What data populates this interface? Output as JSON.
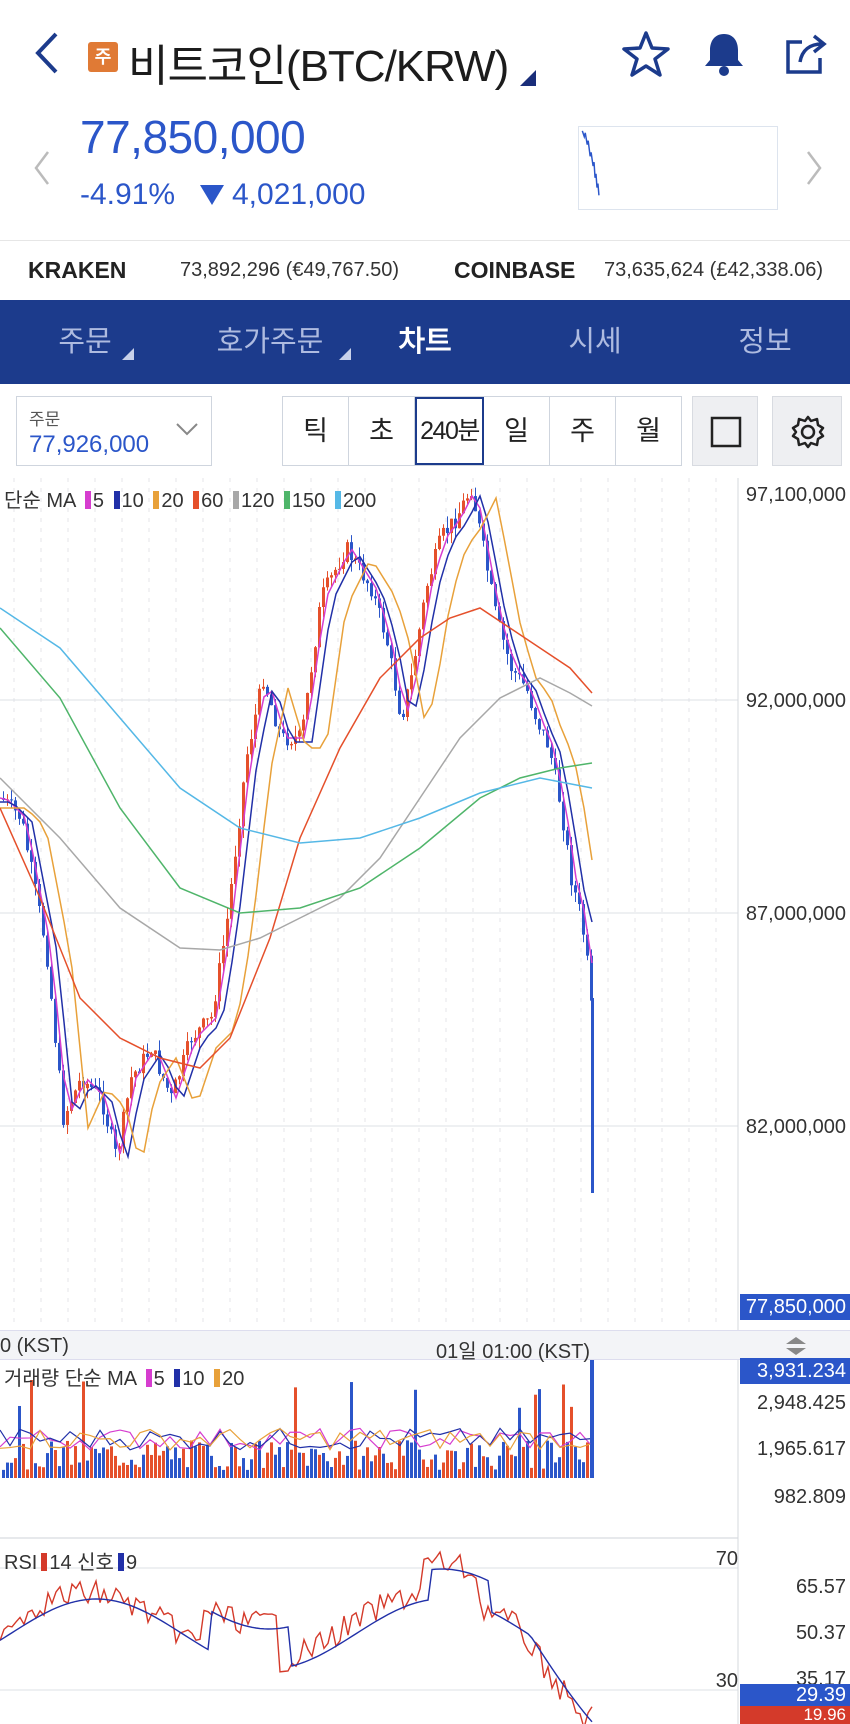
{
  "header": {
    "badge": "주",
    "title": "비트코인(BTC/KRW)"
  },
  "quote": {
    "price": "77,850,000",
    "change_pct": "-4.91%",
    "change_amount": "4,021,000"
  },
  "exchanges": [
    {
      "name": "KRAKEN",
      "value": "73,892,296 (€49,767.50)"
    },
    {
      "name": "COINBASE",
      "value": "73,635,624 (£42,338.06)"
    }
  ],
  "tabs": [
    "주문",
    "호가주문",
    "차트",
    "시세",
    "정보"
  ],
  "active_tab": "차트",
  "order": {
    "label": "주문",
    "value": "77,926,000"
  },
  "periods": [
    "틱",
    "초",
    "240분",
    "일",
    "주",
    "월"
  ],
  "active_period": "240분",
  "main_chart": {
    "legend_title": "단순 MA",
    "legend_items": [
      {
        "label": "5",
        "color": "#d63dcf"
      },
      {
        "label": "10",
        "color": "#2130a8"
      },
      {
        "label": "20",
        "color": "#e8a13a"
      },
      {
        "label": "60",
        "color": "#e5502b"
      },
      {
        "label": "120",
        "color": "#a8a8a8"
      },
      {
        "label": "150",
        "color": "#4fb56a"
      },
      {
        "label": "200",
        "color": "#55b8e6"
      }
    ],
    "y_ticks": [
      "97,100,000",
      "92,000,000",
      "87,000,000",
      "82,000,000"
    ],
    "current_price_tag": "77,850,000",
    "time_left": "0 (KST)",
    "time_mid": "01일 01:00 (KST)"
  },
  "volume_chart": {
    "legend_title": "거래량 단순 MA",
    "legend_items": [
      {
        "label": "5",
        "color": "#d63dcf"
      },
      {
        "label": "10",
        "color": "#2130a8"
      },
      {
        "label": "20",
        "color": "#e8a13a"
      }
    ],
    "y_ticks": [
      "2,948.425",
      "1,965.617",
      "982.809"
    ],
    "current_tag": "3,931.234"
  },
  "rsi_chart": {
    "legend_title": "RSI",
    "period_label": "14",
    "signal_label": "신호",
    "signal_period": "9",
    "rsi_color": "#d43a2a",
    "signal_color": "#2130a8",
    "level_high": "70",
    "level_low": "30",
    "y_ticks": [
      "65.57",
      "50.37",
      "35.17"
    ],
    "current_rsi_tag": "29.39",
    "current_signal_tag": "19.96"
  },
  "colors": {
    "accent": "#1c3b8c",
    "down": "#2b56c9",
    "up": "#e5502b"
  }
}
